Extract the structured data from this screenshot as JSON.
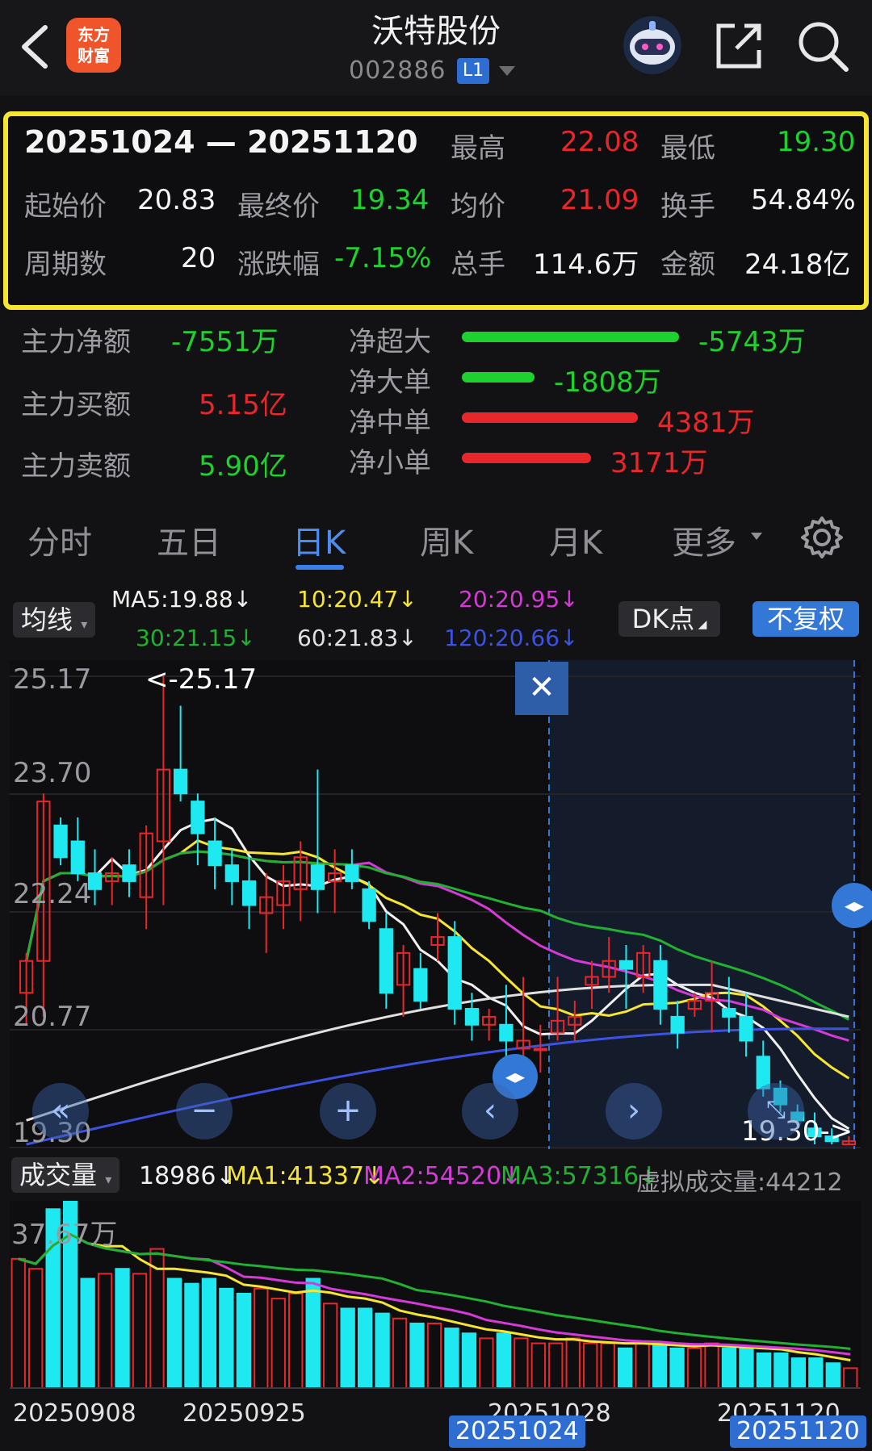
{
  "header": {
    "logo_text": "东方\n财富",
    "title": "沃特股份",
    "code": "002886",
    "level": "L1"
  },
  "summary": {
    "range": "20251024 — 20251120",
    "high_label": "最高",
    "high": "22.08",
    "low_label": "最低",
    "low": "19.30",
    "open_label": "起始价",
    "open": "20.83",
    "close_label": "最终价",
    "close": "19.34",
    "avg_label": "均价",
    "avg": "21.09",
    "turnover_label": "换手",
    "turnover": "54.84%",
    "periods_label": "周期数",
    "periods": "20",
    "change_label": "涨跌幅",
    "change": "-7.15%",
    "volume_label": "总手",
    "volume": "114.6万",
    "amount_label": "金额",
    "amount": "24.18亿"
  },
  "fund_flow": {
    "net_label": "主力净额",
    "net": "-7551万",
    "buy_label": "主力买额",
    "buy": "5.15亿",
    "sell_label": "主力卖额",
    "sell": "5.90亿",
    "rows": [
      {
        "label": "净超大",
        "value": "-5743万",
        "color": "#1fd12e",
        "width": 0.84
      },
      {
        "label": "净大单",
        "value": "-1808万",
        "color": "#1fd12e",
        "width": 0.28
      },
      {
        "label": "净中单",
        "value": "4381万",
        "color": "#e8272b",
        "width": 0.68
      },
      {
        "label": "净小单",
        "value": "3171万",
        "color": "#e8272b",
        "width": 0.5
      }
    ]
  },
  "tabs": [
    "分时",
    "五日",
    "日K",
    "周K",
    "月K",
    "更多"
  ],
  "ma": {
    "selector": "均线",
    "ma5": "MA5:19.88↓",
    "ma10": "10:20.47↓",
    "ma20": "20:20.95↓",
    "ma30": "30:21.15↓",
    "ma60": "60:21.83↓",
    "ma120": "120:20.66↓",
    "dk": "DK点",
    "adjust": "不复权"
  },
  "price_axis": [
    "25.17",
    "23.70",
    "22.24",
    "20.77",
    "19.30"
  ],
  "markers": {
    "high": "<-25.17",
    "low": "19.30->"
  },
  "volume": {
    "selector": "成交量",
    "current": "18986↓",
    "ma1": "MA1:41337↓",
    "ma2": "MA2:54520↓",
    "ma3": "MA3:57316↓",
    "virtual": "虚拟成交量:44212",
    "axis_top": "37.67万"
  },
  "dates": [
    "20250908",
    "20250925",
    "20251028",
    "20251120"
  ],
  "range_start": "20251024",
  "range_end": "20251120",
  "colors": {
    "up": "#e8272b",
    "down": "#1fd12e",
    "cyan": "#1ee8f0",
    "accent": "#3378d6",
    "highlight": "#f6e533"
  },
  "chart_data": {
    "type": "candlestick",
    "ylim": [
      19.3,
      25.17
    ],
    "candles": [
      [
        21.2,
        21.7,
        20.8,
        21.6
      ],
      [
        21.6,
        23.7,
        20.9,
        23.6
      ],
      [
        23.3,
        23.4,
        22.8,
        22.9
      ],
      [
        23.1,
        23.4,
        22.6,
        22.7
      ],
      [
        22.7,
        23.0,
        22.3,
        22.5
      ],
      [
        22.6,
        22.9,
        22.3,
        22.7
      ],
      [
        22.8,
        23.0,
        22.4,
        22.6
      ],
      [
        22.4,
        23.3,
        22.0,
        23.2
      ],
      [
        23.1,
        25.17,
        22.3,
        24.0
      ],
      [
        24.0,
        24.8,
        23.6,
        23.7
      ],
      [
        23.6,
        23.7,
        22.8,
        23.2
      ],
      [
        23.1,
        23.4,
        22.5,
        22.8
      ],
      [
        22.8,
        23.0,
        22.3,
        22.6
      ],
      [
        22.6,
        22.9,
        22.0,
        22.3
      ],
      [
        22.2,
        22.7,
        21.7,
        22.4
      ],
      [
        22.3,
        22.8,
        22.0,
        22.6
      ],
      [
        22.5,
        23.1,
        22.1,
        22.9
      ],
      [
        22.8,
        24.0,
        22.2,
        22.5
      ],
      [
        22.6,
        23.0,
        22.2,
        22.7
      ],
      [
        22.8,
        23.0,
        22.5,
        22.6
      ],
      [
        22.5,
        22.6,
        22.0,
        22.1
      ],
      [
        22.0,
        22.2,
        21.0,
        21.2
      ],
      [
        21.3,
        21.8,
        20.9,
        21.7
      ],
      [
        21.5,
        21.7,
        21.0,
        21.1
      ],
      [
        21.8,
        22.2,
        21.6,
        21.9
      ],
      [
        21.9,
        22.1,
        20.8,
        21.0
      ],
      [
        21.0,
        21.2,
        20.6,
        20.8
      ],
      [
        20.8,
        21.0,
        20.6,
        20.9
      ],
      [
        20.8,
        21.3,
        20.4,
        20.6
      ],
      [
        20.5,
        21.4,
        20.3,
        20.6
      ],
      [
        20.5,
        20.8,
        20.2,
        20.5
      ],
      [
        20.7,
        21.4,
        20.6,
        20.85
      ],
      [
        20.8,
        21.1,
        20.6,
        20.9
      ],
      [
        21.3,
        21.6,
        21.0,
        21.4
      ],
      [
        21.4,
        21.9,
        21.2,
        21.6
      ],
      [
        21.6,
        21.8,
        21.0,
        21.5
      ],
      [
        21.4,
        21.8,
        21.2,
        21.7
      ],
      [
        21.6,
        21.8,
        20.8,
        21.0
      ],
      [
        20.9,
        21.1,
        20.5,
        20.7
      ],
      [
        21.0,
        21.2,
        20.9,
        21.1
      ],
      [
        21.1,
        21.6,
        20.7,
        21.2
      ],
      [
        21.0,
        21.4,
        20.7,
        20.9
      ],
      [
        20.9,
        21.2,
        20.4,
        20.6
      ],
      [
        20.4,
        20.6,
        19.9,
        20.0
      ],
      [
        20.0,
        20.1,
        19.7,
        19.8
      ],
      [
        19.7,
        19.8,
        19.5,
        19.6
      ],
      [
        19.5,
        19.7,
        19.3,
        19.4
      ],
      [
        19.4,
        19.5,
        19.3,
        19.34
      ],
      [
        19.3,
        19.4,
        19.3,
        19.34
      ]
    ],
    "volumes": [
      26,
      24,
      36,
      37.67,
      22,
      23,
      24,
      23,
      28,
      22,
      21,
      22,
      20,
      19,
      20,
      18,
      19,
      22,
      17,
      16,
      16,
      15,
      14,
      13,
      13,
      12,
      11,
      10,
      11,
      10,
      9,
      9,
      10,
      9,
      9,
      8,
      9,
      9,
      8,
      8,
      9,
      8,
      8,
      7,
      7,
      6,
      6,
      5,
      4
    ]
  }
}
